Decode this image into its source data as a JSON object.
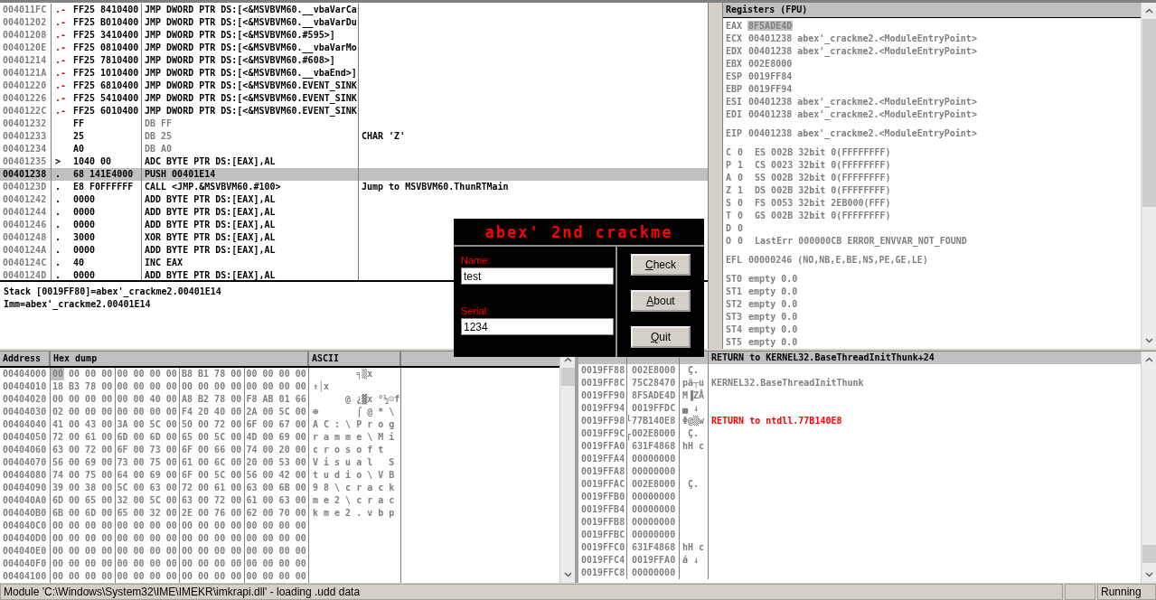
{
  "disassembly": {
    "rows": [
      {
        "address": "004011FC",
        "marker": ".-",
        "kind": "jump",
        "hex": "FF25 8410400",
        "code": "JMP DWORD PTR DS:[<&MSVBVM60.__vbaVarCa",
        "selected": false
      },
      {
        "address": "00401202",
        "marker": ".-",
        "kind": "jump",
        "hex": "FF25 B010400",
        "code": "JMP DWORD PTR DS:[<&MSVBVM60.__vbaVarDu",
        "selected": false
      },
      {
        "address": "00401208",
        "marker": ".-",
        "kind": "jump",
        "hex": "FF25 3410400",
        "code": "JMP DWORD PTR DS:[<&MSVBVM60.#595>]",
        "selected": false
      },
      {
        "address": "0040120E",
        "marker": ".-",
        "kind": "jump",
        "hex": "FF25 0810400",
        "code": "JMP DWORD PTR DS:[<&MSVBVM60.__vbaVarMo",
        "selected": false
      },
      {
        "address": "00401214",
        "marker": ".-",
        "kind": "jump",
        "hex": "FF25 7810400",
        "code": "JMP DWORD PTR DS:[<&MSVBVM60.#608>]",
        "selected": false
      },
      {
        "address": "0040121A",
        "marker": ".-",
        "kind": "jump",
        "hex": "FF25 1010400",
        "code": "JMP DWORD PTR DS:[<&MSVBVM60.__vbaEnd>]",
        "selected": false
      },
      {
        "address": "00401220",
        "marker": ".-",
        "kind": "jump",
        "hex": "FF25 6810400",
        "code": "JMP DWORD PTR DS:[<&MSVBVM60.EVENT_SINK",
        "selected": false
      },
      {
        "address": "00401226",
        "marker": ".-",
        "kind": "jump",
        "hex": "FF25 5410400",
        "code": "JMP DWORD PTR DS:[<&MSVBVM60.EVENT_SINK",
        "selected": false
      },
      {
        "address": "0040122C",
        "marker": ".-",
        "kind": "jump",
        "hex": "FF25 6010400",
        "code": "JMP DWORD PTR DS:[<&MSVBVM60.EVENT_SINK",
        "selected": false
      },
      {
        "address": "00401232",
        "kind": "data",
        "hex": "FF",
        "code": "DB FF",
        "selected": false
      },
      {
        "address": "00401233",
        "kind": "data",
        "hex": "25",
        "code": "DB 25",
        "comment": "CHAR 'Z'",
        "selected": false
      },
      {
        "address": "00401234",
        "kind": "data",
        "hex": "A0",
        "code": "DB A0",
        "selected": false
      },
      {
        "address": "00401235",
        "marker": ">",
        "kind": "code",
        "hex": "1040 00",
        "code": "ADC BYTE PTR DS:[EAX],AL",
        "selected": false
      },
      {
        "address": "00401238",
        "marker": ".",
        "kind": "code",
        "hex": "68 141E4000",
        "code": "PUSH 00401E14",
        "selected": true
      },
      {
        "address": "0040123D",
        "marker": ".",
        "kind": "code",
        "hex": "E8 F0FFFFFF",
        "code": "CALL <JMP.&MSVBVM60.#100>",
        "comment": "Jump to MSVBVM60.ThunRTMain",
        "selected": false
      },
      {
        "address": "00401242",
        "marker": ".",
        "kind": "code",
        "hex": "0000",
        "code": "ADD BYTE PTR DS:[EAX],AL",
        "selected": false
      },
      {
        "address": "00401244",
        "marker": ".",
        "kind": "code",
        "hex": "0000",
        "code": "ADD BYTE PTR DS:[EAX],AL",
        "selected": false
      },
      {
        "address": "00401246",
        "marker": ".",
        "kind": "code",
        "hex": "0000",
        "code": "ADD BYTE PTR DS:[EAX],AL",
        "selected": false
      },
      {
        "address": "00401248",
        "marker": ".",
        "kind": "code",
        "hex": "3000",
        "code": "XOR BYTE PTR DS:[EAX],AL",
        "selected": false
      },
      {
        "address": "0040124A",
        "marker": ".",
        "kind": "code",
        "hex": "0000",
        "code": "ADD BYTE PTR DS:[EAX],AL",
        "selected": false
      },
      {
        "address": "0040124C",
        "marker": ".",
        "kind": "code",
        "hex": "40",
        "code": "INC EAX",
        "selected": false
      },
      {
        "address": "0040124D",
        "marker": ".",
        "kind": "code",
        "hex": "0000",
        "code": "ADD BYTE PTR DS:[EAX],AL",
        "selected": false
      }
    ]
  },
  "info": {
    "lines": [
      "Stack [0019FF80]=abex'_crackme2.00401E14",
      "Imm=abex'_crackme2.00401E14"
    ]
  },
  "registers": {
    "title": "Registers (FPU)",
    "groups": [
      {
        "lines": [
          {
            "kind": "register",
            "name": "EAX",
            "value": "8F5ADE4D",
            "highlighted": true
          },
          {
            "kind": "register",
            "name": "ECX",
            "value": "00401238",
            "comment": "abex'_crackme2.<ModuleEntryPoint>",
            "highlighted": false
          },
          {
            "kind": "register",
            "name": "EDX",
            "value": "00401238",
            "comment": "abex'_crackme2.<ModuleEntryPoint>",
            "highlighted": false
          },
          {
            "kind": "register",
            "name": "EBX",
            "value": "002E8000",
            "highlighted": false
          },
          {
            "kind": "register",
            "name": "ESP",
            "value": "0019FF84",
            "highlighted": false
          },
          {
            "kind": "register",
            "name": "EBP",
            "value": "0019FF94",
            "highlighted": false
          },
          {
            "kind": "register",
            "name": "ESI",
            "value": "00401238",
            "comment": "abex'_crackme2.<ModuleEntryPoint>",
            "highlighted": false
          },
          {
            "kind": "register",
            "name": "EDI",
            "value": "00401238",
            "comment": "abex'_crackme2.<ModuleEntryPoint>",
            "highlighted": false
          }
        ]
      },
      {
        "lines": [
          {
            "kind": "register",
            "name": "EIP",
            "value": "00401238",
            "comment": "abex'_crackme2.<ModuleEntryPoint>",
            "highlighted": false
          }
        ]
      },
      {
        "lines": [
          {
            "kind": "flag",
            "name": "C",
            "value": "0",
            "comment": "ES 002B 32bit 0(FFFFFFFF)",
            "highlighted": false
          },
          {
            "kind": "flag",
            "name": "P",
            "value": "1",
            "comment": "CS 0023 32bit 0(FFFFFFFF)",
            "highlighted": false
          },
          {
            "kind": "flag",
            "name": "A",
            "value": "0",
            "comment": "SS 002B 32bit 0(FFFFFFFF)",
            "highlighted": false
          },
          {
            "kind": "flag",
            "name": "Z",
            "value": "1",
            "comment": "DS 002B 32bit 0(FFFFFFFF)",
            "highlighted": false
          },
          {
            "kind": "flag",
            "name": "S",
            "value": "0",
            "comment": "FS 0053 32bit 2EB000(FFF)",
            "highlighted": false
          },
          {
            "kind": "flag",
            "name": "T",
            "value": "0",
            "comment": "GS 002B 32bit 0(FFFFFFFF)",
            "highlighted": false
          },
          {
            "kind": "flag",
            "name": "D",
            "value": "0",
            "highlighted": false
          },
          {
            "kind": "flag",
            "name": "O",
            "value": "0",
            "comment": "LastErr 000000CB ERROR_ENVVAR_NOT_FOUND",
            "highlighted": false
          }
        ]
      },
      {
        "lines": [
          {
            "kind": "register",
            "name": "EFL",
            "value": "00000246",
            "comment": "(NO,NB,E,BE,NS,PE,GE,LE)",
            "highlighted": false
          }
        ]
      },
      {
        "lines": [
          {
            "kind": "register",
            "name": "ST0",
            "value": "empty 0.0",
            "highlighted": false
          },
          {
            "kind": "register",
            "name": "ST1",
            "value": "empty 0.0",
            "highlighted": false
          },
          {
            "kind": "register",
            "name": "ST2",
            "value": "empty 0.0",
            "highlighted": false
          },
          {
            "kind": "register",
            "name": "ST3",
            "value": "empty 0.0",
            "highlighted": false
          },
          {
            "kind": "register",
            "name": "ST4",
            "value": "empty 0.0",
            "highlighted": false
          },
          {
            "kind": "register",
            "name": "ST5",
            "value": "empty 0.0",
            "highlighted": false
          }
        ]
      }
    ]
  },
  "dump": {
    "columns": [
      "Address",
      "Hex dump",
      "ASCII"
    ],
    "rows": [
      {
        "address": "00404000",
        "hex": "00 00 00 00 00 00 00 00 B8 B1 78 00 00 00 00 00",
        "ascii": "        ╕▒x",
        "selected": true
      },
      {
        "address": "00404010",
        "hex": "18 B3 78 00 00 00 00 00 00 00 00 00 00 00 00 00",
        "ascii": "↑│x",
        "selected": false
      },
      {
        "address": "00404020",
        "hex": "00 00 00 00 00 00 40 00 A8 B2 78 00 F8 AB 01 66",
        "ascii": "      @ ¿▓x °½☺f",
        "selected": false
      },
      {
        "address": "00404030",
        "hex": "02 00 00 00 00 00 00 00 F4 20 40 00 2A 00 5C 00",
        "ascii": "☻       ⌠ @ * \\",
        "selected": false
      },
      {
        "address": "00404040",
        "hex": "41 00 43 00 3A 00 5C 00 50 00 72 00 6F 00 67 00",
        "ascii": "A C : \\ P r o g",
        "selected": false
      },
      {
        "address": "00404050",
        "hex": "72 00 61 00 6D 00 6D 00 65 00 5C 00 4D 00 69 00",
        "ascii": "r a m m e \\ M i",
        "selected": false
      },
      {
        "address": "00404060",
        "hex": "63 00 72 00 6F 00 73 00 6F 00 66 00 74 00 20 00",
        "ascii": "c r o s o f t",
        "selected": false
      },
      {
        "address": "00404070",
        "hex": "56 00 69 00 73 00 75 00 61 00 6C 00 20 00 53 00",
        "ascii": "V i s u a l   S",
        "selected": false
      },
      {
        "address": "00404080",
        "hex": "74 00 75 00 64 00 69 00 6F 00 5C 00 56 00 42 00",
        "ascii": "t u d i o \\ V B",
        "selected": false
      },
      {
        "address": "00404090",
        "hex": "39 00 38 00 5C 00 63 00 72 00 61 00 63 00 6B 00",
        "ascii": "9 8 \\ c r a c k",
        "selected": false
      },
      {
        "address": "004040A0",
        "hex": "6D 00 65 00 32 00 5C 00 63 00 72 00 61 00 63 00",
        "ascii": "m e 2 \\ c r a c",
        "selected": false
      },
      {
        "address": "004040B0",
        "hex": "6B 00 6D 00 65 00 32 00 2E 00 76 00 62 00 70 00",
        "ascii": "k m e 2 . v b p",
        "selected": false
      },
      {
        "address": "004040C0",
        "hex": "00 00 00 00 00 00 00 00 00 00 00 00 00 00 00 00",
        "selected": false
      },
      {
        "address": "004040D0",
        "hex": "00 00 00 00 00 00 00 00 00 00 00 00 00 00 00 00",
        "selected": false
      },
      {
        "address": "004040E0",
        "hex": "00 00 00 00 00 00 00 00 00 00 00 00 00 00 00 00",
        "selected": false
      },
      {
        "address": "004040F0",
        "hex": "00 00 00 00 00 00 00 00 00 00 00 00 00 00 00 00",
        "selected": false
      },
      {
        "address": "00404100",
        "hex": "00 00 00 00 00 00 00 00 00 00 00 00 00 00 00 00",
        "selected": false
      }
    ]
  },
  "stack": {
    "rows": [
      {
        "comment": "RETURN to KERNEL32.BaseThreadInitThunk+24",
        "selected": true
      },
      {
        "address": "0019FF88",
        "value": "002E8000",
        "ascii": " Ç.",
        "selected": false
      },
      {
        "address": "0019FF8C",
        "value": "75C28470",
        "ascii": "pä┬u",
        "comment": "KERNEL32.BaseThreadInitThunk",
        "color": "#808080",
        "selected": false
      },
      {
        "address": "0019FF90",
        "value": "8F5ADE4D",
        "ascii": "M▐ZÅ",
        "selected": false
      },
      {
        "address": "0019FF94",
        "value": "0019FFDC",
        "ascii": "▄ ↓",
        "selected": false
      },
      {
        "address": "0019FF98",
        "value": "77B140E8",
        "frame_end": true,
        "ascii": "Φ@▒w",
        "comment": "RETURN to ntdll.77B140E8",
        "color": "#ff0000",
        "selected": false
      },
      {
        "address": "0019FF9C",
        "value": "002E8000",
        "frame_start": true,
        "ascii": " Ç.",
        "selected": false
      },
      {
        "address": "0019FFA0",
        "value": "631F4868",
        "ascii": "hH c",
        "selected": false
      },
      {
        "address": "0019FFA4",
        "value": "00000000",
        "selected": false
      },
      {
        "address": "0019FFA8",
        "value": "00000000",
        "selected": false
      },
      {
        "address": "0019FFAC",
        "value": "002E8000",
        "ascii": " Ç.",
        "selected": false
      },
      {
        "address": "0019FFB0",
        "value": "00000000",
        "selected": false
      },
      {
        "address": "0019FFB4",
        "value": "00000000",
        "selected": false
      },
      {
        "address": "0019FFB8",
        "value": "00000000",
        "selected": false
      },
      {
        "address": "0019FFBC",
        "value": "00000000",
        "selected": false
      },
      {
        "address": "0019FFC0",
        "value": "631F4868",
        "ascii": "hH c",
        "selected": false
      },
      {
        "address": "0019FFC4",
        "value": "0019FFA0",
        "ascii": "á ↓",
        "selected": false
      },
      {
        "address": "0019FFC8",
        "value": "00000000",
        "selected": false
      }
    ]
  },
  "dialog": {
    "title": "abex' 2nd crackme",
    "fields": [
      {
        "label": "Name:",
        "value": "test"
      },
      {
        "label": "Serial:",
        "value": "1234"
      }
    ],
    "buttons": [
      {
        "label": "Check",
        "mnemonic": true
      },
      {
        "label": "About",
        "mnemonic": true
      },
      {
        "label": "Quit",
        "mnemonic": true
      }
    ]
  },
  "status_bar": {
    "message": "Module 'C:\\Windows\\System32\\IME\\IMEKR\\imkrapi.dll' - loading .udd data",
    "state": "Running"
  }
}
